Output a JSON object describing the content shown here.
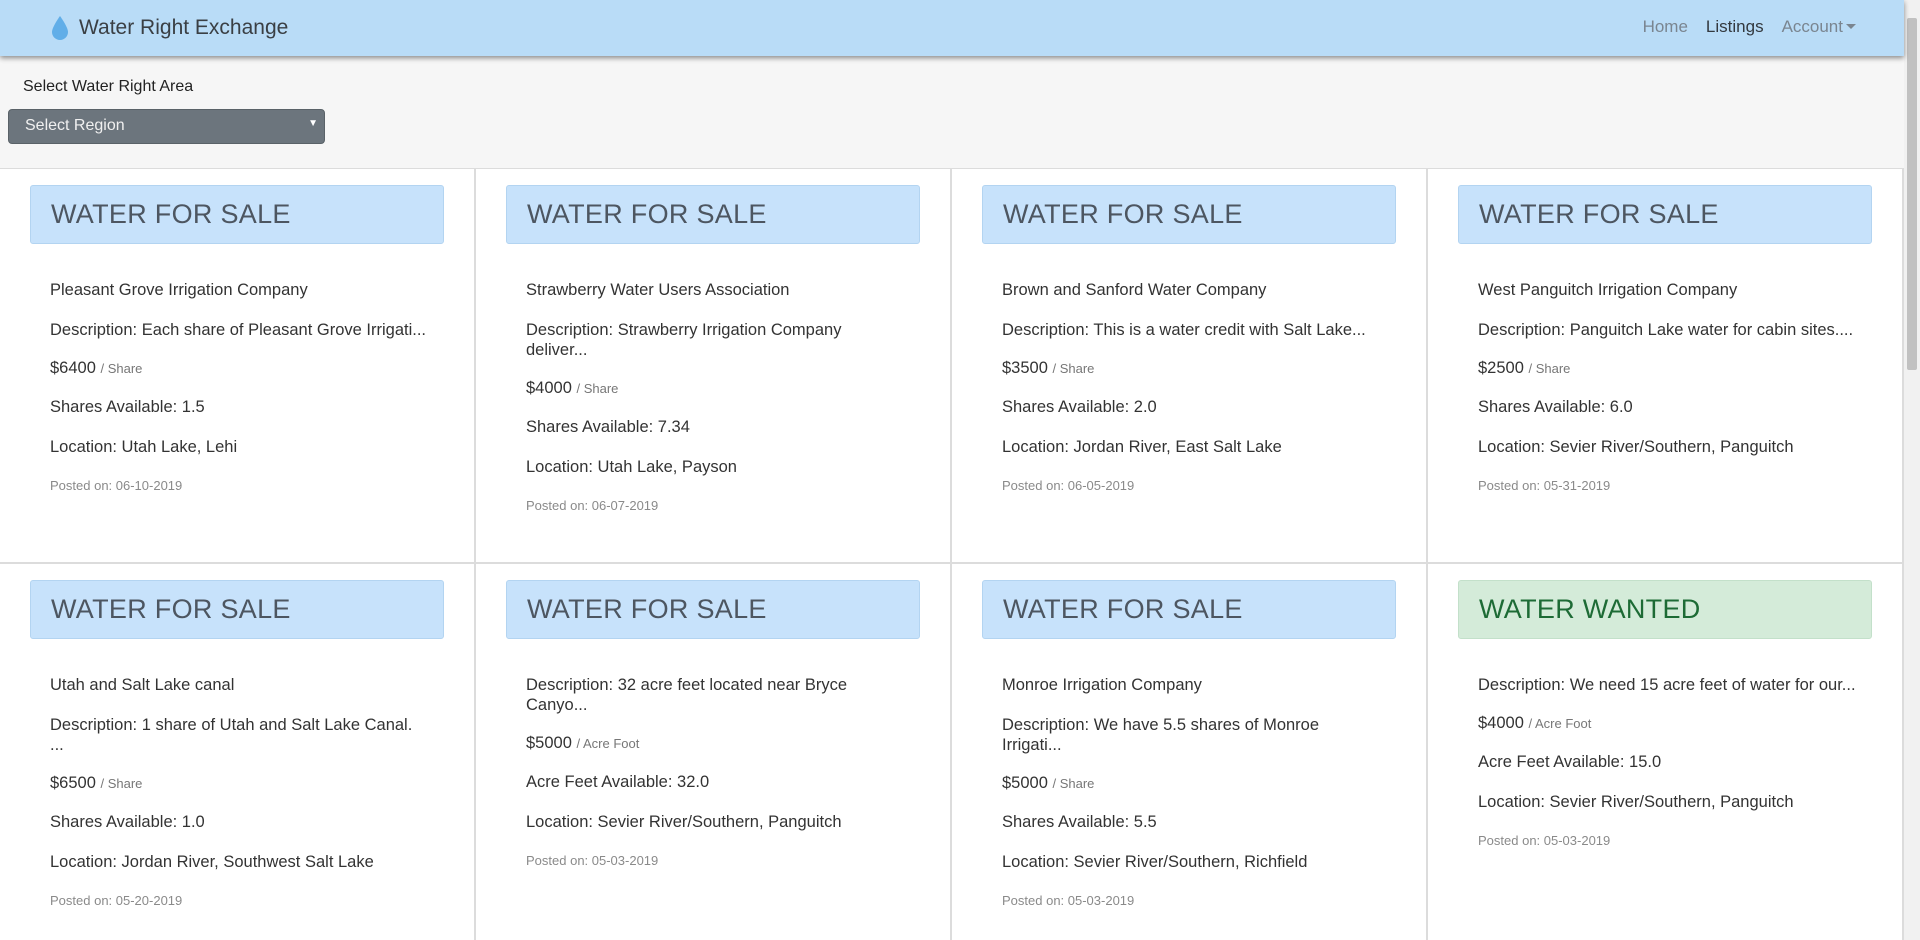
{
  "app": {
    "title": "Water Right Exchange",
    "colors": {
      "navbar": "#b9dcf7",
      "sale_header": "#c7e2fb",
      "wanted_header": "#d4ebd9",
      "drop": "#61aee8"
    }
  },
  "nav": {
    "home": "Home",
    "listings": "Listings",
    "account": "Account"
  },
  "filter": {
    "label": "Select Water Right Area",
    "select_value": "Select Region"
  },
  "listings": [
    {
      "type": "WATER FOR SALE",
      "company": "Pleasant Grove Irrigation Company",
      "description": "Description: Each share of Pleasant Grove Irrigati...",
      "price": "$6400",
      "unit": "/ Share",
      "available": "Shares Available: 1.5",
      "location": "Location: Utah Lake, Lehi",
      "posted": "Posted on: 06-10-2019"
    },
    {
      "type": "WATER FOR SALE",
      "company": "Strawberry Water Users Association",
      "description": "Description: Strawberry Irrigation Company deliver...",
      "price": "$4000",
      "unit": "/ Share",
      "available": "Shares Available: 7.34",
      "location": "Location: Utah Lake, Payson",
      "posted": "Posted on: 06-07-2019"
    },
    {
      "type": "WATER FOR SALE",
      "company": "Brown and Sanford Water Company",
      "description": "Description: This is a water credit with Salt Lake...",
      "price": "$3500",
      "unit": "/ Share",
      "available": "Shares Available: 2.0",
      "location": "Location: Jordan River, East Salt Lake",
      "posted": "Posted on: 06-05-2019"
    },
    {
      "type": "WATER FOR SALE",
      "company": "West Panguitch Irrigation Company",
      "description": "Description: Panguitch Lake water for cabin sites....",
      "price": "$2500",
      "unit": "/ Share",
      "available": "Shares Available: 6.0",
      "location": "Location: Sevier River/Southern, Panguitch",
      "posted": "Posted on: 05-31-2019"
    },
    {
      "type": "WATER FOR SALE",
      "company": "Utah and Salt Lake canal",
      "description": "Description: 1 share of Utah and Salt Lake Canal. ...",
      "price": "$6500",
      "unit": "/ Share",
      "available": "Shares Available: 1.0",
      "location": "Location: Jordan River, Southwest Salt Lake",
      "posted": "Posted on: 05-20-2019"
    },
    {
      "type": "WATER FOR SALE",
      "company": "",
      "description": "Description: 32 acre feet located near Bryce Canyo...",
      "price": "$5000",
      "unit": "/ Acre Foot",
      "available": "Acre Feet Available: 32.0",
      "location": "Location: Sevier River/Southern, Panguitch",
      "posted": "Posted on: 05-03-2019"
    },
    {
      "type": "WATER FOR SALE",
      "company": "Monroe Irrigation Company",
      "description": "Description: We have 5.5 shares of Monroe Irrigati...",
      "price": "$5000",
      "unit": "/ Share",
      "available": "Shares Available: 5.5",
      "location": "Location: Sevier River/Southern, Richfield",
      "posted": "Posted on: 05-03-2019"
    },
    {
      "type": "WATER WANTED",
      "company": "",
      "description": "Description: We need 15 acre feet of water for our...",
      "price": "$4000",
      "unit": "/ Acre Foot",
      "available": "Acre Feet Available: 15.0",
      "location": "Location: Sevier River/Southern, Panguitch",
      "posted": "Posted on: 05-03-2019"
    }
  ]
}
